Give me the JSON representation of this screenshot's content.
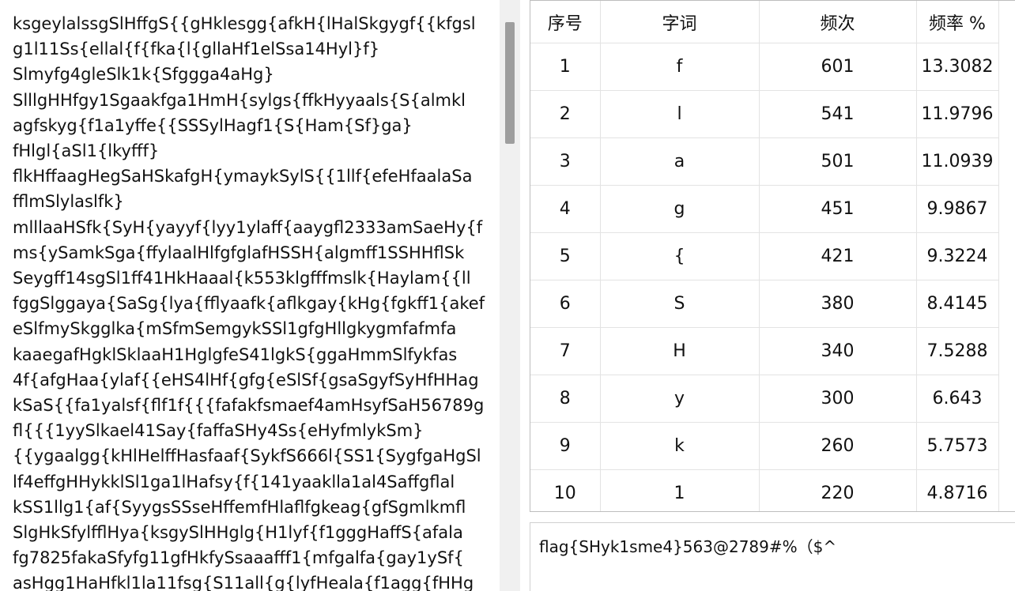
{
  "text_pane": {
    "lines": [
      "ksgeylalssgSlHffgS{{gHklesgg{afkH{lHalSkgygf{{kfgsl",
      "g1l11Ss{ellal{f{fka{l{gllaHf1elSsa14Hyl}f}",
      "Slmyfg4gleSlk1k{Sfggga4aHg}",
      "SlllgHHfgy1Sgaakfga1HmH{sylgs{ffkHyyaals{S{almkl",
      "agfskyg{f1a1yffe{{SSSylHagf1{S{Ham{Sf}ga}",
      "fHlgl{aSl1{lkyfff}",
      "flkHffaagHegSaHSkafgH{ymaykSylS{{1llf{efeHfaalaSa",
      "fflmSlylaslfk}",
      "mlllaaHSfk{SyH{yayyf{lyy1ylaff{aaygfl2333amSaeHy{f",
      "ms{ySamkSga{ffylaalHlfgfglafHSSH{algmff1SSHHflSk",
      "Seygff14sgSl1ff41HkHaaal{k553klgfffmslk{Haylam{{ll",
      "fggSlggaya{SaSg{lya{fflyaafk{aflkgay{kHg{fgkff1{akef",
      "eSlfmySkgglka{mSfmSemgykSSl1gfgHllgkygmfafmfa",
      "kaaegafHgklSklaaH1HglgfeS41lgkS{ggaHmmSlfykfas",
      "4f{afgHaa{ylaf{{eHS4lHf{gfg{eSlSf{gsaSgyfSyHfHHag",
      "kSaS{{fa1yalsf{flf1f{{{fafakfsmaef4amHsyfSaH56789g",
      "fl{{{1yySlkael41Say{faffaSHy4Ss{eHyfmlykSm}",
      "{{ygaalgg{kHlHelffHasfaaf{SykfS666l{SS1{SygfgaHgSl",
      "lf4effgHHykklSl1ga1lHafsy{f{141yaaklla1al4Saffgflal",
      "kSS1llg1{af{SyygsSSseHffemfHlaflfgkeag{gfSgmlkmfl",
      "SlgHkSfylfflHya{ksgySlHHglg{H1lyf{f1gggHaffS{afala",
      "fg7825fakaSfyfg11gfHkfySsaaafff1{mfgalfa{gay1ySf{",
      "asHgg1HaHfkl1la11fsg{S11all{g{lyfHeala{f1agg{fHHg"
    ]
  },
  "table": {
    "headers": [
      "序号",
      "字词",
      "频次",
      "频率 %"
    ],
    "rows": [
      {
        "idx": "1",
        "char": "f",
        "count": "601",
        "pct": "13.3082"
      },
      {
        "idx": "2",
        "char": "l",
        "count": "541",
        "pct": "11.9796"
      },
      {
        "idx": "3",
        "char": "a",
        "count": "501",
        "pct": "11.0939"
      },
      {
        "idx": "4",
        "char": "g",
        "count": "451",
        "pct": "9.9867"
      },
      {
        "idx": "5",
        "char": "{",
        "count": "421",
        "pct": "9.3224"
      },
      {
        "idx": "6",
        "char": "S",
        "count": "380",
        "pct": "8.4145"
      },
      {
        "idx": "7",
        "char": "H",
        "count": "340",
        "pct": "7.5288"
      },
      {
        "idx": "8",
        "char": "y",
        "count": "300",
        "pct": "6.643"
      },
      {
        "idx": "9",
        "char": "k",
        "count": "260",
        "pct": "5.7573"
      },
      {
        "idx": "10",
        "char": "1",
        "count": "220",
        "pct": "4.8716"
      }
    ]
  },
  "result": {
    "text": "flag{SHyk1sme4}563@2789#%（$^"
  },
  "colors": {
    "scrollbar_track": "#f0f0f0",
    "scrollbar_thumb": "#9e9e9e",
    "grid_line": "#e3e3e3"
  }
}
